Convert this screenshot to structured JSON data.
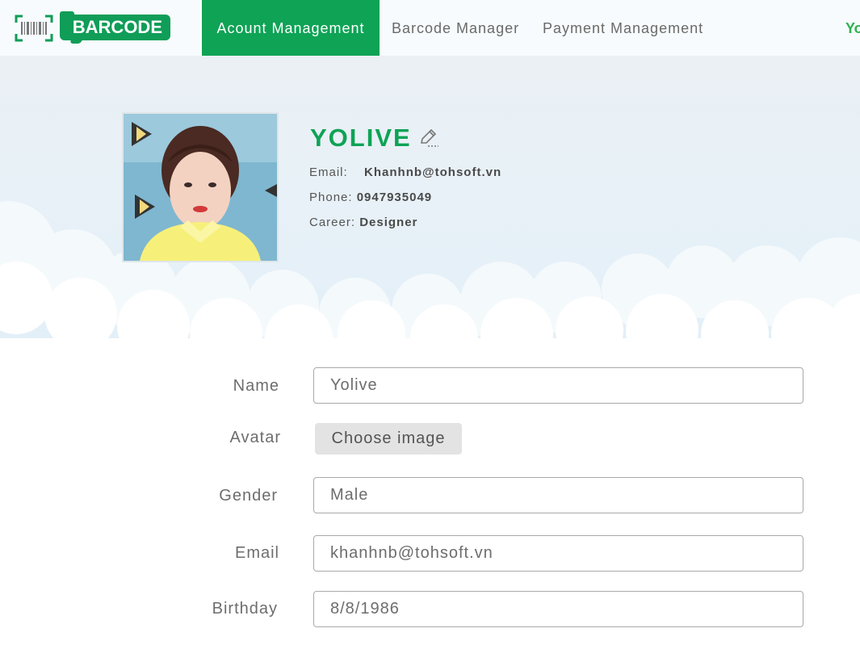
{
  "brand": {
    "logo_text": "BARCODE",
    "color": "#0f9d58"
  },
  "nav": {
    "items": [
      {
        "label": "Acount Management",
        "active": true
      },
      {
        "label": "Barcode Manager",
        "active": false
      },
      {
        "label": "Payment Management",
        "active": false
      }
    ],
    "user_label": "Yo"
  },
  "profile": {
    "name": "YOLIVE",
    "edit_icon": "pencil-icon",
    "email_label": "Email:",
    "email": "Khanhnb@tohsoft.vn",
    "phone_label": "Phone:",
    "phone": "0947935049",
    "career_label": "Career:",
    "career": "Designer"
  },
  "form": {
    "name": {
      "label": "Name",
      "value": "Yolive"
    },
    "avatar": {
      "label": "Avatar",
      "button": "Choose image"
    },
    "gender": {
      "label": "Gender",
      "value": "Male"
    },
    "email": {
      "label": "Email",
      "value": "khanhnb@tohsoft.vn"
    },
    "birthday": {
      "label": "Birthday",
      "value": "8/8/1986"
    }
  },
  "colors": {
    "accent": "#0ea355",
    "hero_bg": "#e8f1f7"
  }
}
